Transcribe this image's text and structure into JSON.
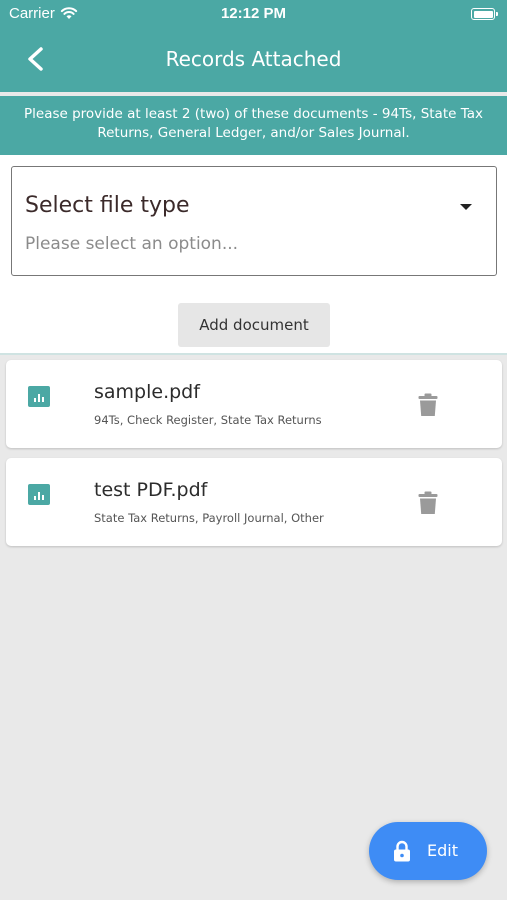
{
  "status_bar": {
    "carrier": "Carrier",
    "time": "12:12 PM"
  },
  "header": {
    "title": "Records Attached",
    "back_icon": "chevron-left-icon"
  },
  "notice": {
    "text": "Please provide at least 2 (two) of these documents - 94Ts, State Tax Returns, General Ledger, and/or Sales Journal."
  },
  "file_type_select": {
    "label": "Select file type",
    "placeholder": "Please select an option..."
  },
  "add_document": {
    "label": "Add document"
  },
  "documents": [
    {
      "name": "sample.pdf",
      "types": "94Ts, Check Register, State Tax Returns",
      "icon": "bar-chart-icon"
    },
    {
      "name": "test PDF.pdf",
      "types": "State Tax Returns, Payroll Journal, Other",
      "icon": "bar-chart-icon"
    }
  ],
  "fab": {
    "label": "Edit",
    "icon": "lock-icon"
  },
  "colors": {
    "primary": "#4ba8a4",
    "fab": "#3e8cf5",
    "background": "#e9e9e9"
  }
}
